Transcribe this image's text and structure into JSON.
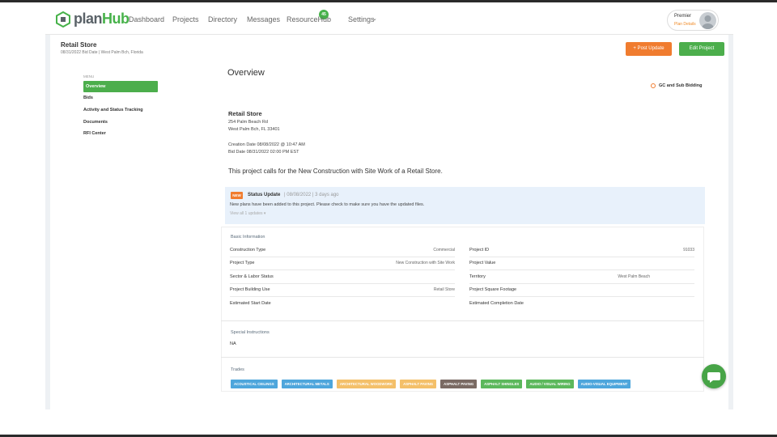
{
  "brand": {
    "name_prefix": "plan",
    "name_suffix": "Hub",
    "green": "#47b24a",
    "orange": "#f07c2f"
  },
  "nav": {
    "links": [
      "Dashboard",
      "Projects",
      "Directory",
      "Messages",
      "ResourceHub",
      "Settings"
    ],
    "messages_badge": "45",
    "user": {
      "plan": "Premier",
      "details_link": "Plan Details"
    }
  },
  "project": {
    "title": "Retail Store",
    "subtitle": "08/31/2022 Bid Date  |  West Palm Bch, Florida",
    "post_update_label": "+ Post Update",
    "edit_label": "Edit Project"
  },
  "menu": {
    "label": "MENU",
    "items": [
      "Overview",
      "Bids",
      "Activity and Status Tracking",
      "Documents",
      "RFI Center"
    ],
    "active": "Overview"
  },
  "overview": {
    "heading": "Overview",
    "bidding_type": "GC and Sub Bidding",
    "name": "Retail Store",
    "address1": "254 Palm Beach Rd",
    "address2": "West Palm Bch, FL 33401",
    "creation": "Creation Date 08/08/2022 @ 10:47 AM",
    "bid_date": "Bid Date 08/31/2022 02:00 PM EST",
    "description": "This project calls for the New Construction with Site Work of a  Retail Store."
  },
  "status_update": {
    "badge": "NEW",
    "title": "Status Update",
    "date": "| 08/08/2022 | 3 days ago",
    "text": "New plans have been added to this project. Please check to make sure you have the updated files.",
    "link": "View all 1 updates ▾"
  },
  "basic_info": {
    "label": "Basic Information",
    "left": [
      {
        "key": "Construction Type",
        "value": "Commercial"
      },
      {
        "key": "Project Type",
        "value": "New Construction with Site Work"
      },
      {
        "key": "Sector & Labor Status",
        "value": ""
      },
      {
        "key": "Project Building Use",
        "value": "Retail Store"
      },
      {
        "key": "Estimated Start Date",
        "value": ""
      }
    ],
    "right": [
      {
        "key": "Project ID",
        "value": "91033"
      },
      {
        "key": "Project Value",
        "value": ""
      },
      {
        "key": "Territory",
        "value": "West Palm Beach"
      },
      {
        "key": "Project Square Footage",
        "value": ""
      },
      {
        "key": "Estimated Completion Date",
        "value": ""
      }
    ]
  },
  "special_instructions": {
    "label": "Special Instructions",
    "value": "NA"
  },
  "trades": {
    "label": "Trades",
    "items": [
      {
        "name": "ACOUSTICAL CEILINGS",
        "color": "#4ea6dc"
      },
      {
        "name": "ARCHITECTURAL METALS",
        "color": "#4ea6dc"
      },
      {
        "name": "ARCHITECTURAL WOODWORK",
        "color": "#f4c06a"
      },
      {
        "name": "ASPHALT PAVING",
        "color": "#f4c06a"
      },
      {
        "name": "ASPHALT PAVING",
        "color": "#7a6a63"
      },
      {
        "name": "ASPHALT SHINGLES",
        "color": "#5cb85c"
      },
      {
        "name": "AUDIO / VISUAL WIRING",
        "color": "#5cb85c"
      },
      {
        "name": "AUDIO-VISUAL EQUIPMENT",
        "color": "#4ea6dc"
      }
    ]
  }
}
